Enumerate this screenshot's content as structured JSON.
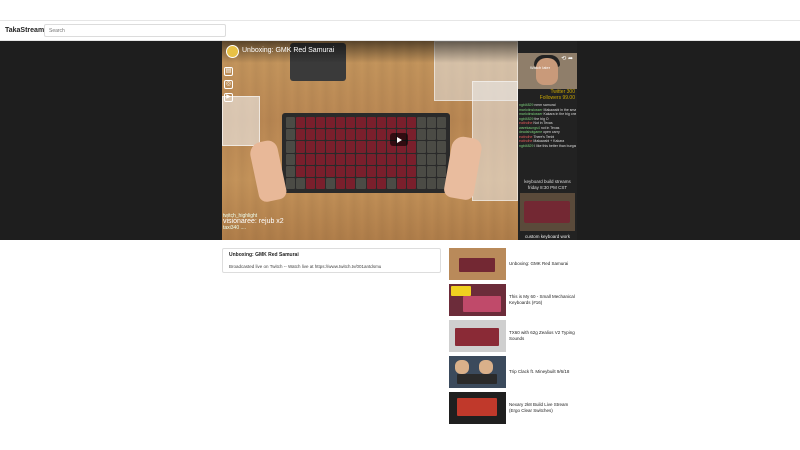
{
  "app": {
    "title": "TakaStream"
  },
  "search": {
    "placeholder": "Search"
  },
  "player": {
    "title": "Unboxing: GMK Red Samurai",
    "overlay_user_line": "twitch_highlight",
    "overlay_sub_line": "visionaree: rejub x2",
    "overlay_bottom": "taxi340 ...."
  },
  "stream_panel": {
    "cam_label": "Watch later",
    "stats": [
      "Twitter 300",
      "Followers 99.00"
    ],
    "chat": [
      {
        "user": "ngbl4829",
        "text": "nmm samurai"
      },
      {
        "user": "marlotinslosser",
        "text": "Makawabi in the small one"
      },
      {
        "user": "marlotinslosser",
        "text": "Kakara in the big one yikes"
      },
      {
        "user": "ngbl4829",
        "text": "the big O"
      },
      {
        "user": "eatindhe",
        "text": "Not in Texas"
      },
      {
        "user": "warekaungs4",
        "text": "not in Texas"
      },
      {
        "user": "deadshotgame",
        "text": "open carry"
      },
      {
        "user": "eatindhe",
        "text": "There's Tenbi"
      },
      {
        "user": "eatindhe",
        "text": "Makawabi + Kakara"
      },
      {
        "user": "ngbl4829",
        "text": "I like this better than burgandy"
      }
    ],
    "schedule_line1": "keyboard build streams",
    "schedule_line2": "friday 8:30 PM CST",
    "custom_label": "custom keyboard work"
  },
  "description": {
    "title": "Unboxing: GMK Red Samurai",
    "text": "Broadcasted live on Twitch -- Watch live at https://www.twitch.tv/001antdsmu"
  },
  "recommended": [
    {
      "title": "Unboxing: GMK Red Samurai"
    },
    {
      "title": "This is My 60 - Small Mechanical Keyboards (#16)"
    },
    {
      "title": "TX60 with 62g Zealios V2 Typing Sounds"
    },
    {
      "title": "Trip Clack ft. Mineybuilt 9/6/18"
    },
    {
      "title": "Nexary 2k8 Build Live Stream (Ergo Clear Switches)"
    }
  ],
  "colors": {
    "accent": "#e8c146",
    "stage_bg": "#1e1e1e",
    "keycap_red": "#7a1f2c",
    "keycap_grey": "#4b4b45"
  }
}
